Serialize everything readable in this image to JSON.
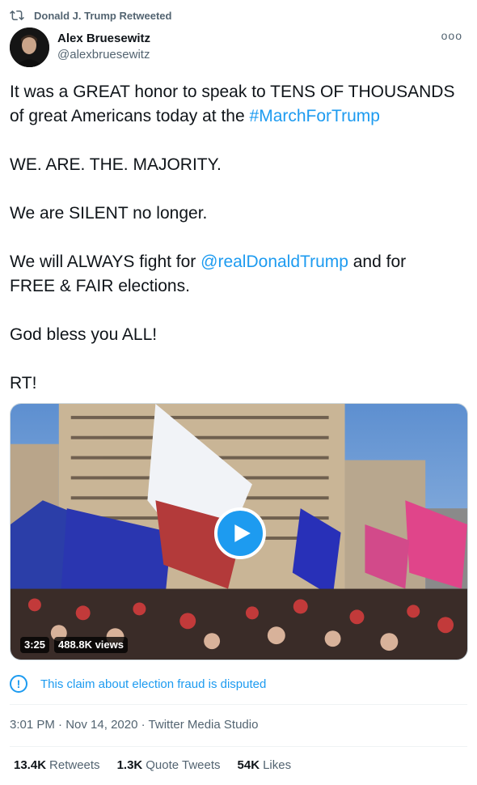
{
  "retweet_header": {
    "icon": "retweet-icon",
    "label": "Donald J. Trump Retweeted"
  },
  "author": {
    "name": "Alex Bruesewitz",
    "handle": "@alexbruesewitz"
  },
  "menu": {
    "icon": "more-icon",
    "glyph": "ooo"
  },
  "tweet": {
    "line1": "It was a GREAT honor to speak to TENS OF THOUSANDS",
    "line2_prefix": "of great Americans today at the ",
    "hashtag": "#MarchForTrump",
    "line3": "WE. ARE. THE. MAJORITY.",
    "line4": "We are SILENT no longer.",
    "line5_prefix": "We will ALWAYS fight for ",
    "mention": "@realDonaldTrump",
    "line5_suffix": " and for",
    "line6": "FREE & FAIR elections.",
    "line7": "God bless you ALL!",
    "line8": "RT!"
  },
  "video": {
    "duration": "3:25",
    "views": "488.8K views",
    "play_icon": "play-icon"
  },
  "notice": {
    "icon": "exclamation-icon",
    "text": "This claim about election fraud is disputed"
  },
  "meta": {
    "time": "3:01 PM",
    "date": "Nov 14, 2020",
    "source": "Twitter Media Studio",
    "separator": "·"
  },
  "stats": {
    "retweets": {
      "count": "13.4K",
      "label": "Retweets"
    },
    "quotes": {
      "count": "1.3K",
      "label": "Quote Tweets"
    },
    "likes": {
      "count": "54K",
      "label": "Likes"
    }
  },
  "colors": {
    "link": "#1d9bf0",
    "secondary_text": "#536471",
    "primary_text": "#0f1419"
  }
}
